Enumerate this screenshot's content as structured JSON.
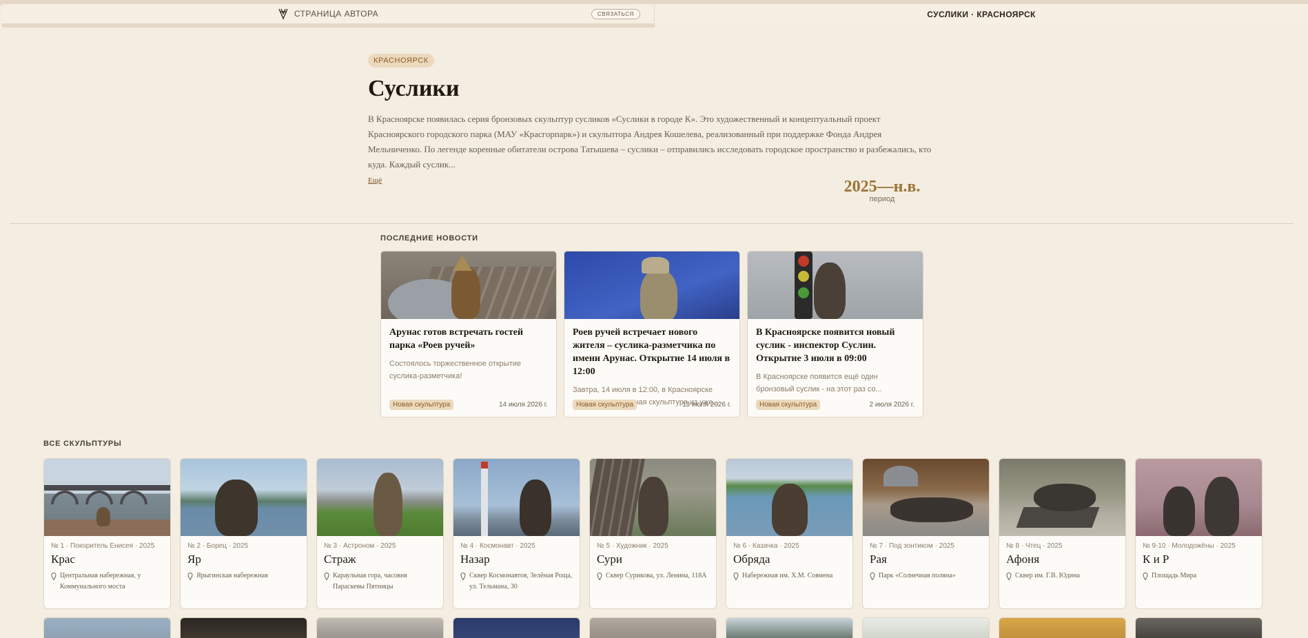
{
  "tabs": {
    "author_label": "СТРАНИЦА АВТОРА",
    "contact_label": "СВЯЗАТЬСЯ",
    "current_label": "СУСЛИКИ · КРАСНОЯРСК"
  },
  "hero": {
    "city": "КРАСНОЯРСК",
    "title": "Суслики",
    "description": "В Красноярске появилась серия бронзовых скульптур сусликов «Суслики в городе К». Это художественный и концептуальный проект Красноярского городского парка (МАУ «Красгорпарк») и скульптора Андрея Кошелева, реализованный при поддержке Фонда Андрея Мельниченко. По легенде коренные обитатели острова Татышева – суслики – отправились исследовать городское пространство и разбежались, кто куда. Каждый суслик...",
    "more_label": "Ещё",
    "period_value": "2025—н.в.",
    "period_label": "период"
  },
  "news": {
    "section_title": "ПОСЛЕДНИЕ НОВОСТИ",
    "items": [
      {
        "title": "Арунас готов встречать гостей парка «Роев ручей»",
        "snippet": "Состоялось торжественное открытие суслика-разметчика!",
        "tag": "Новая скульптура",
        "date": "14 июля 2026 г."
      },
      {
        "title": "Роев ручей встречает нового жителя – суслика-разметчика по имени Арунас. Открытие 14 июля в 12:00",
        "snippet": "Завтра, 14 июля в 12:00, в Красноярске откроется очередная скульптура из уже...",
        "tag": "Новая скульптура",
        "date": "13 июля 2026 г."
      },
      {
        "title": "В Красноярске появится новый суслик - инспектор Суслин. Открытие 3 июля в 09:00",
        "snippet": "В Красноярске появится ещё один бронзовый суслик - на этот раз со...",
        "tag": "Новая скульптура",
        "date": "2 июля 2026 г."
      }
    ]
  },
  "sculptures": {
    "section_title": "ВСЕ СКУЛЬПТУРЫ",
    "items": [
      {
        "meta": "№ 1 · Покоритель Енисея · 2025",
        "name": "Крас",
        "location": "Центральная набережная, у Коммунального моста"
      },
      {
        "meta": "№ 2 · Борец · 2025",
        "name": "Яр",
        "location": "Ярыгинская набережная"
      },
      {
        "meta": "№ 3 · Астроном · 2025",
        "name": "Страж",
        "location": "Караульная гора, часовня Параскевы Пятницы"
      },
      {
        "meta": "№ 4 · Космонавт · 2025",
        "name": "Назар",
        "location": "Сквер Космонавтов, Зелёная Роща, ул. Тельмана, 30"
      },
      {
        "meta": "№ 5 · Художник · 2025",
        "name": "Сури",
        "location": "Сквер Сурикова, ул. Ленина, 118А"
      },
      {
        "meta": "№ 6 · Казачка · 2025",
        "name": "Обряда",
        "location": "Набережная им. Х.М. Совмена"
      },
      {
        "meta": "№ 7 · Под зонтиком · 2025",
        "name": "Рая",
        "location": "Парк «Солнечная поляна»"
      },
      {
        "meta": "№ 8 · Чтец · 2025",
        "name": "Афоня",
        "location": "Сквер им. Г.В. Юдина"
      },
      {
        "meta": "№ 9-10 · Молодожёны · 2025",
        "name": "К и Р",
        "location": "Площадь Мира"
      }
    ]
  },
  "colors": {
    "background": "#f4ede2",
    "accent": "#9a7436",
    "tag_bg": "#ecd9bd"
  }
}
